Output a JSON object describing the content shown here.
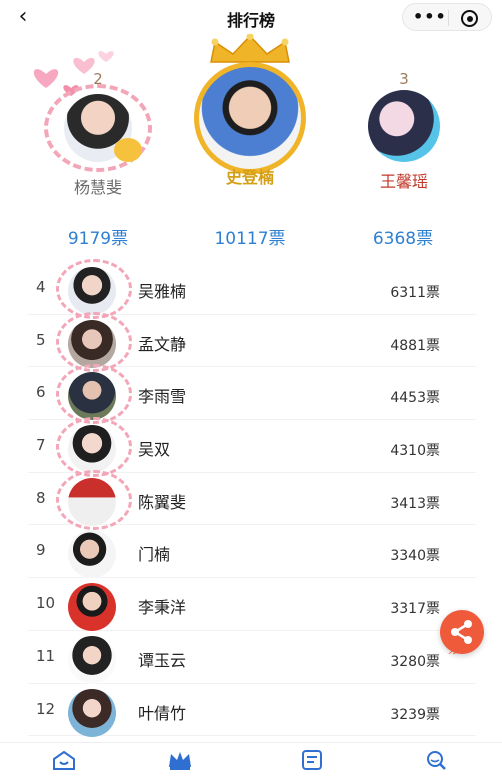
{
  "header": {
    "title": "排行榜",
    "back_icon": "chevron-left-icon",
    "more_icon": "more-dots-icon",
    "close_icon": "target-icon"
  },
  "podium": [
    {
      "rank": "2",
      "name": "杨慧斐",
      "votes": "9179票"
    },
    {
      "rank": "",
      "name": "史登楠",
      "votes": "10117票"
    },
    {
      "rank": "3",
      "name": "王馨瑶",
      "votes": "6368票"
    }
  ],
  "list": [
    {
      "rank": "4",
      "name": "吴雅楠",
      "votes": "6311票",
      "frame": true
    },
    {
      "rank": "5",
      "name": "孟文静",
      "votes": "4881票",
      "frame": true
    },
    {
      "rank": "6",
      "name": "李雨雪",
      "votes": "4453票",
      "frame": true
    },
    {
      "rank": "7",
      "name": "吴双",
      "votes": "4310票",
      "frame": true
    },
    {
      "rank": "8",
      "name": "陈翼斐",
      "votes": "3413票",
      "frame": true
    },
    {
      "rank": "9",
      "name": "门楠",
      "votes": "3340票",
      "frame": false
    },
    {
      "rank": "10",
      "name": "李秉洋",
      "votes": "3317票",
      "frame": false
    },
    {
      "rank": "11",
      "name": "谭玉云",
      "votes": "3280票",
      "frame": false
    },
    {
      "rank": "12",
      "name": "叶倩竹",
      "votes": "3239票",
      "frame": false
    }
  ],
  "share": {
    "label": "分享",
    "icon": "share-icon"
  },
  "nav": [
    {
      "label": "",
      "icon": "home-icon"
    },
    {
      "label": "",
      "icon": "crown-icon"
    },
    {
      "label": "",
      "icon": "note-icon"
    },
    {
      "label": "",
      "icon": "search-icon"
    }
  ],
  "colors": {
    "votes_blue": "#2f80d1",
    "first_gold": "#d4a017",
    "share_red": "#ef5a3b"
  }
}
